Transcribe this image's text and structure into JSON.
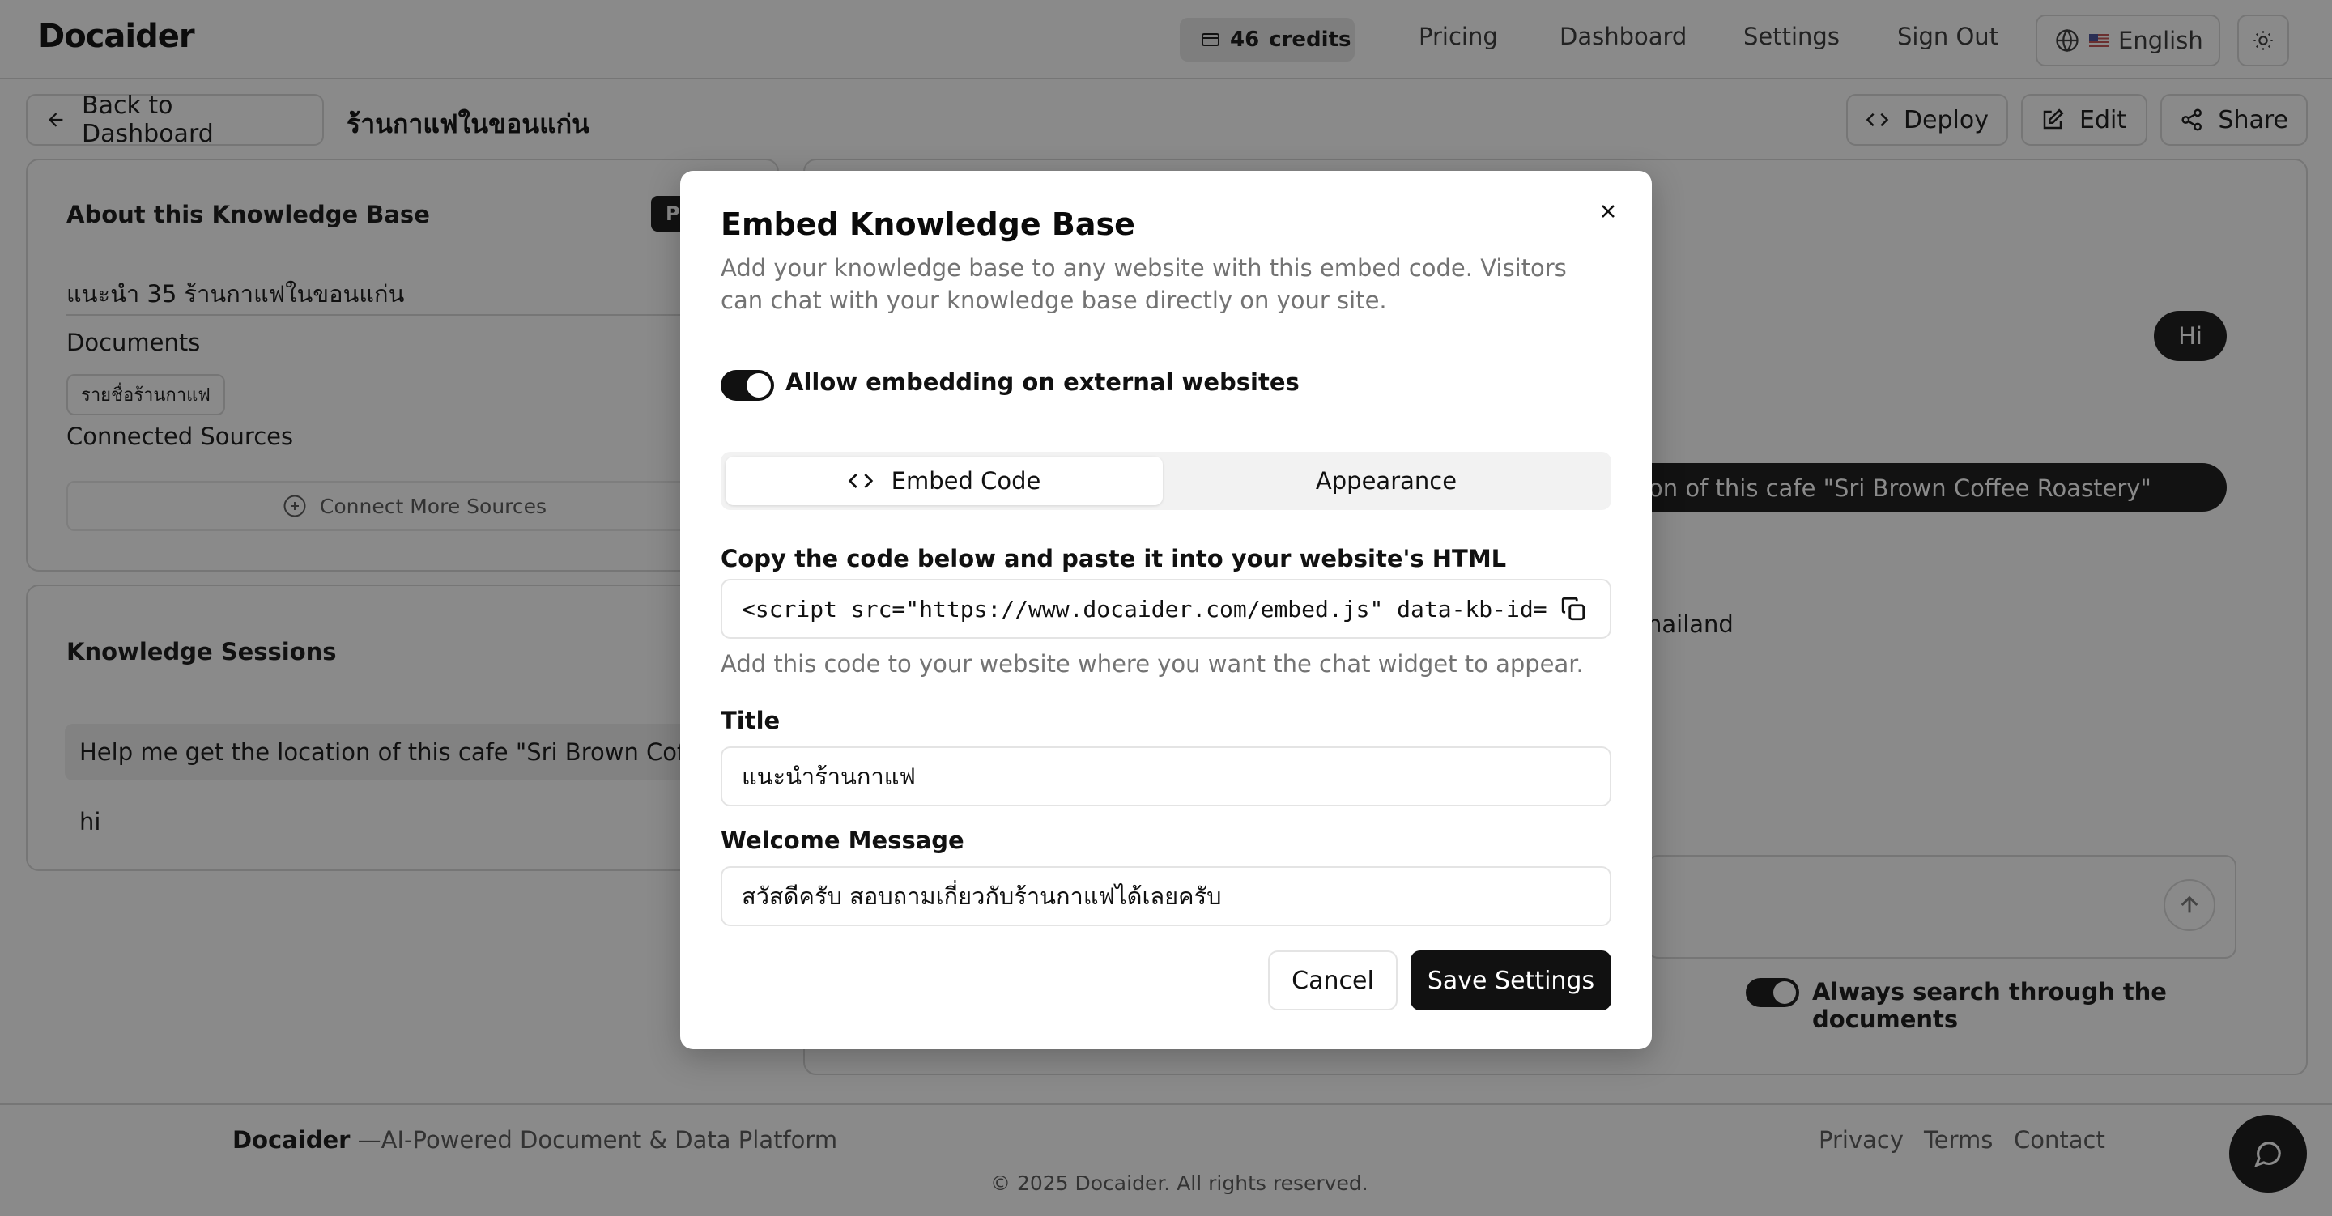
{
  "topbar": {
    "logo": "Docaider",
    "credits_count": "46",
    "credits_label": "credits",
    "nav": [
      "Pricing",
      "Dashboard",
      "Settings",
      "Sign Out"
    ],
    "language": "English",
    "icons": [
      "credit-card-icon",
      "globe-icon",
      "us-flag-icon",
      "sun-icon"
    ]
  },
  "subheader": {
    "back_label": "Back to Dashboard",
    "kb_title": "ร้านกาแฟในขอนแก่น",
    "deploy_label": "Deploy",
    "edit_label": "Edit",
    "share_label": "Share"
  },
  "about": {
    "heading": "About this Knowledge Base",
    "badge": "P",
    "description": "แนะนำ 35 ร้านกาแฟในขอนแก่น",
    "documents_heading": "Documents",
    "documents": [
      "รายชื่อร้านกาแฟ"
    ],
    "connected_heading": "Connected Sources",
    "connect_more": "Connect More Sources"
  },
  "sessions": {
    "heading": "Knowledge Sessions",
    "items": [
      "Help me get the location of this cafe \"Sri Brown Coffee",
      "hi"
    ]
  },
  "chat": {
    "bubble_hi": "Hi",
    "bubble_question": "e location of this cafe \"Sri Brown Coffee Roastery\"",
    "answer_fragment": "hailand",
    "always_search_label": "Always search through the documents"
  },
  "footer": {
    "brand": "Docaider",
    "tagline": " —AI-Powered Document & Data Platform",
    "links": [
      "Privacy",
      "Terms",
      "Contact"
    ],
    "copyright": "© 2025 Docaider. All rights reserved."
  },
  "modal": {
    "title": "Embed Knowledge Base",
    "description": "Add your knowledge base to any website with this embed code. Visitors can chat with your knowledge base directly on your site.",
    "allow_embedding_label": "Allow embedding on external websites",
    "allow_embedding": true,
    "tabs": [
      "Embed Code",
      "Appearance"
    ],
    "active_tab": "Embed Code",
    "code_label": "Copy the code below and paste it into your website's HTML",
    "code_value": "<script src=\"https://www.docaider.com/embed.js\" data-kb-id=",
    "code_hint": "Add this code to your website where you want the chat widget to appear.",
    "title_label": "Title",
    "title_value": "แนะนำร้านกาแฟ",
    "welcome_label": "Welcome Message",
    "welcome_value": "สวัสดีครับ สอบถามเกี่ยวกับร้านกาแฟได้เลยครับ",
    "cancel_label": "Cancel",
    "save_label": "Save Settings"
  },
  "colors": {
    "overlay_bg": "#8a8a8a",
    "modal_bg": "#ffffff",
    "primary": "#111111",
    "muted_text": "#737373"
  }
}
